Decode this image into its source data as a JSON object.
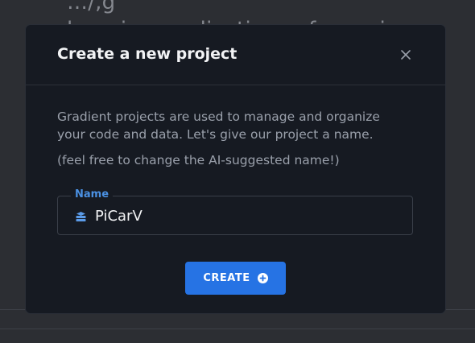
{
  "background": {
    "heading_line_1": "…/,g",
    "heading_line_2": "learning applications of any size or"
  },
  "modal": {
    "title": "Create a new project",
    "close_icon": "close-icon",
    "description": "Gradient projects are used to manage and organize your code and data. Let's give our project a name.",
    "hint": "(feel free to change the AI-suggested name!)",
    "name_field": {
      "label": "Name",
      "value": "PiCarV",
      "icon": "stack-icon"
    },
    "create_button": {
      "label": "CREATE",
      "icon": "plus-circle-icon"
    }
  },
  "colors": {
    "accent": "#2673e4",
    "label_blue": "#4a90e2",
    "modal_bg": "#161a22"
  }
}
